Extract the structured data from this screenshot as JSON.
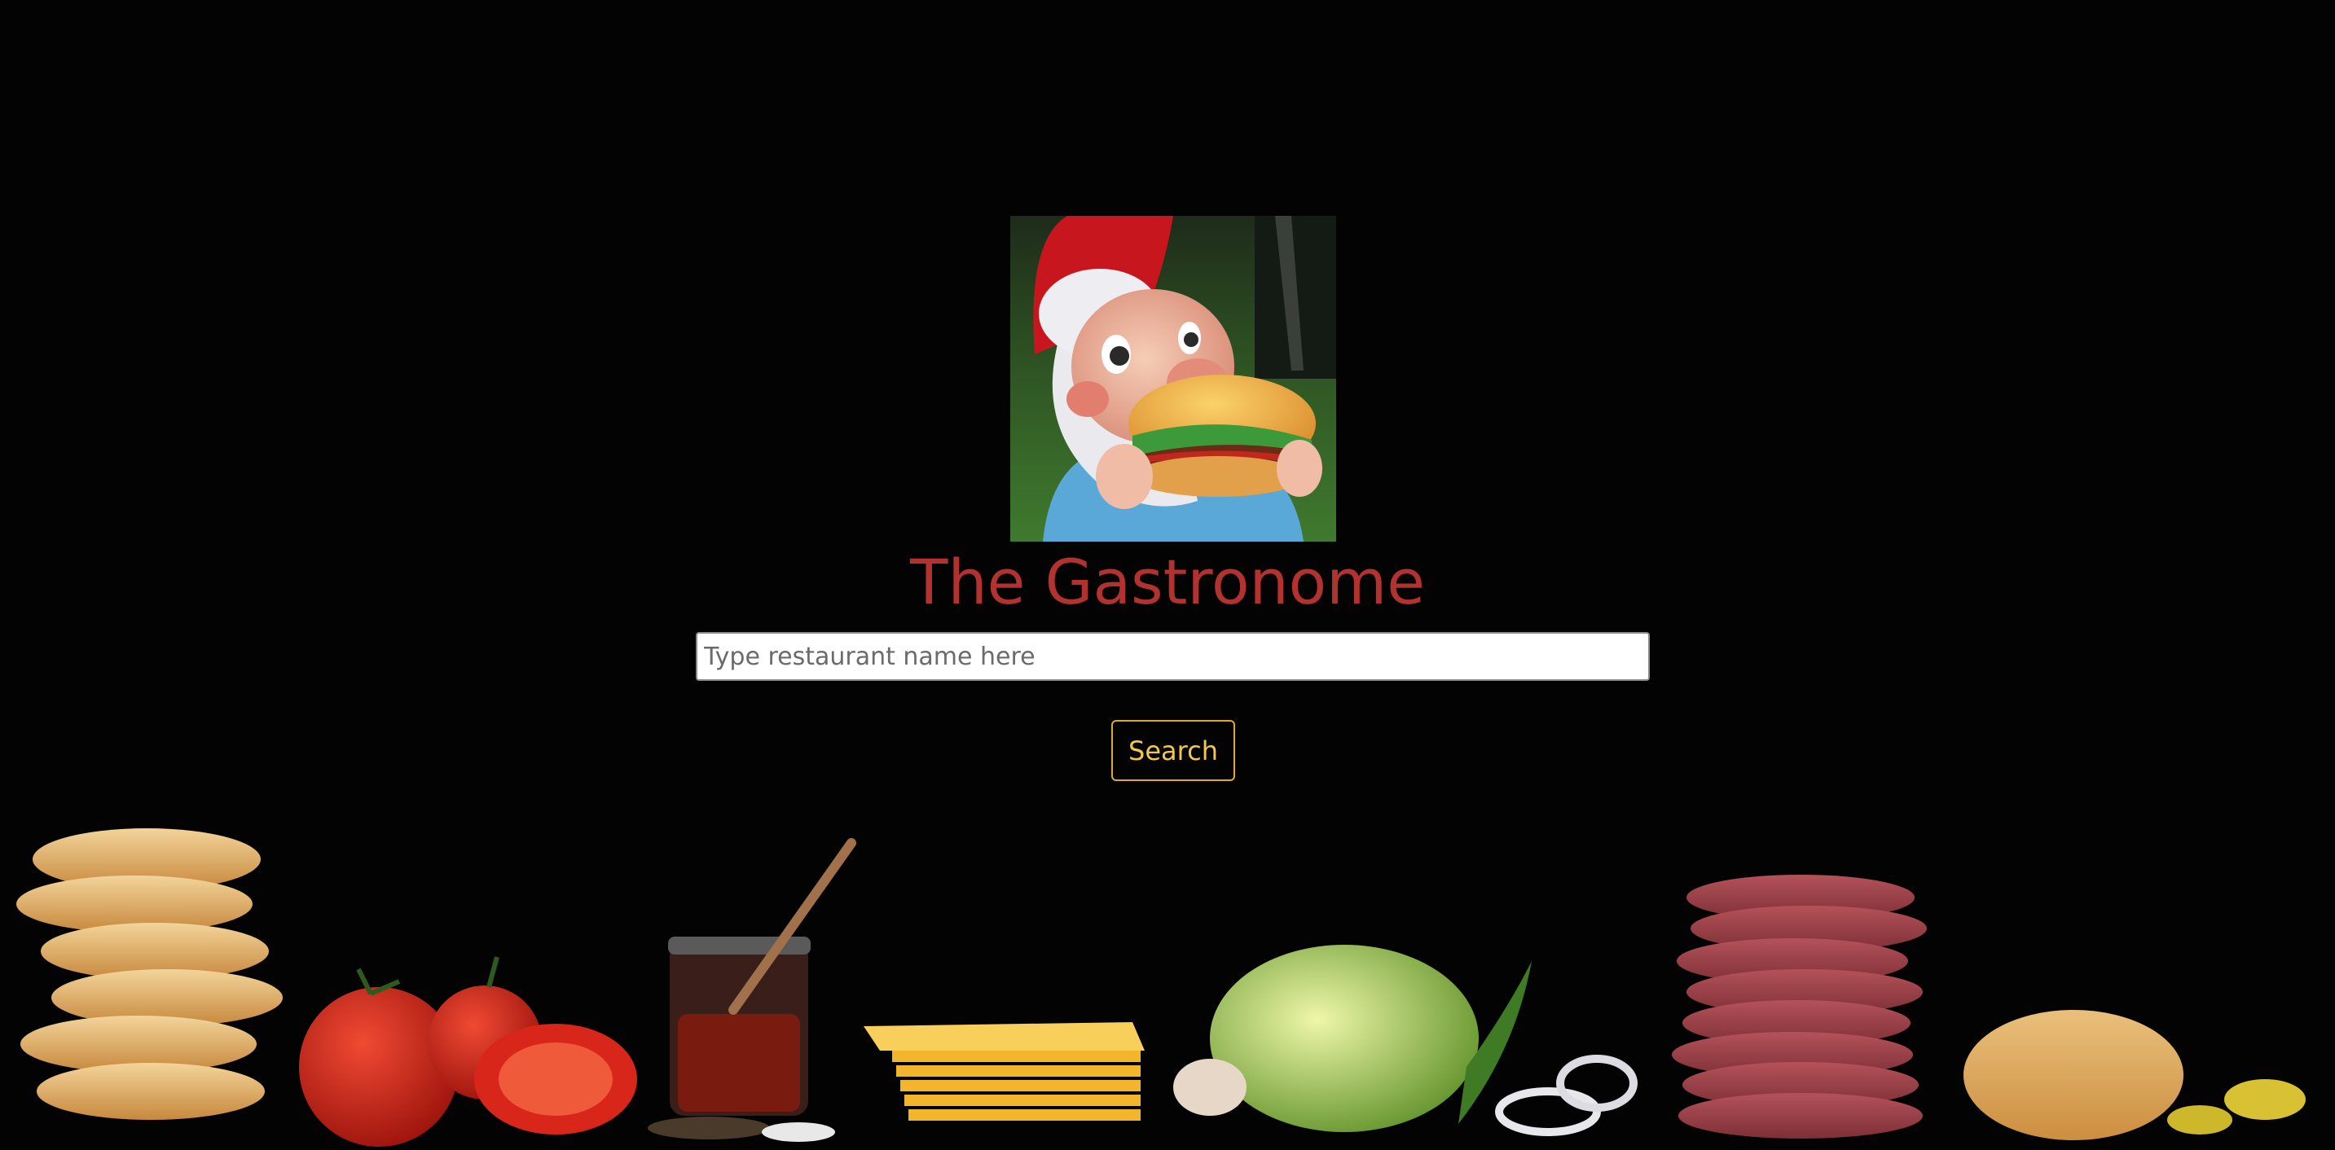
{
  "app": {
    "title": "The Gastronome"
  },
  "search": {
    "placeholder": "Type restaurant name here",
    "value": "",
    "button_label": "Search"
  },
  "images": {
    "logo": "gnome-eating-burger",
    "background": "burger-ingredients-row"
  },
  "colors": {
    "background": "#030303",
    "title": "#b1322f",
    "button_border": "#e0a92b",
    "button_text": "#f2c84a"
  }
}
